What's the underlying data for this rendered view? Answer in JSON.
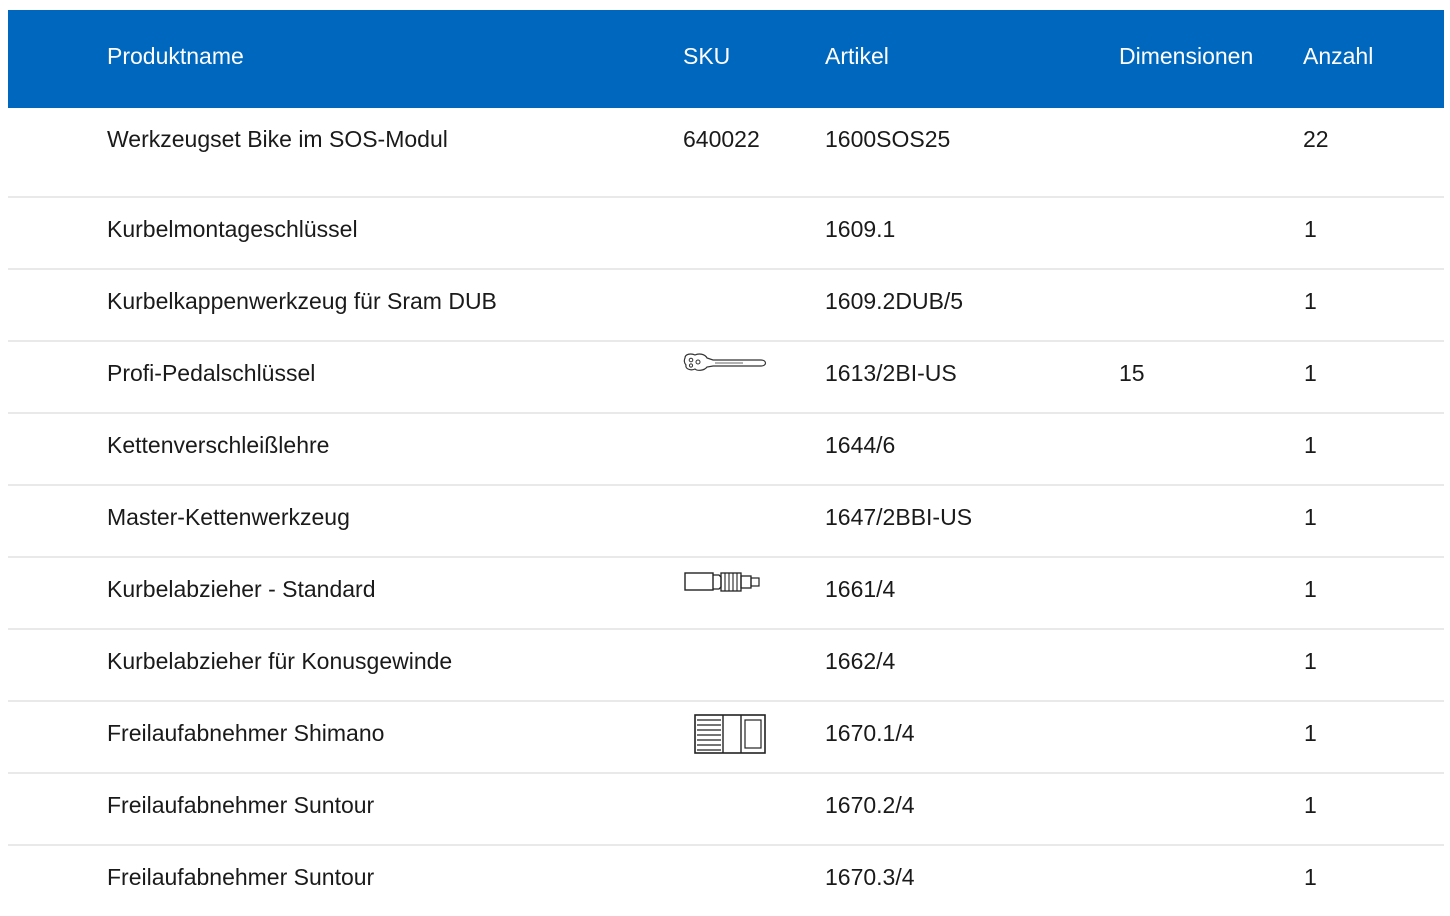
{
  "table": {
    "headers": {
      "name": "Produktname",
      "sku": "SKU",
      "article": "Artikel",
      "dimensions": "Dimensionen",
      "quantity": "Anzahl"
    },
    "rows": [
      {
        "name": "Werkzeugset Bike im SOS-Modul",
        "sku": "640022",
        "article": "1600SOS25",
        "dimensions": "",
        "quantity": "22",
        "icon": ""
      },
      {
        "name": "Kurbelmontageschlüssel",
        "sku": "",
        "article": "1609.1",
        "dimensions": "",
        "quantity": "1",
        "icon": ""
      },
      {
        "name": "Kurbelkappenwerkzeug für Sram DUB",
        "sku": "",
        "article": "1609.2DUB/5",
        "dimensions": "",
        "quantity": "1",
        "icon": ""
      },
      {
        "name": "Profi-Pedalschlüssel",
        "sku": "",
        "article": "1613/2BI-US",
        "dimensions": "15",
        "quantity": "1",
        "icon": "pedal-wrench-icon"
      },
      {
        "name": "Kettenverschleißlehre",
        "sku": "",
        "article": "1644/6",
        "dimensions": "",
        "quantity": "1",
        "icon": ""
      },
      {
        "name": "Master-Kettenwerkzeug",
        "sku": "",
        "article": "1647/2BBI-US",
        "dimensions": "",
        "quantity": "1",
        "icon": ""
      },
      {
        "name": "Kurbelabzieher - Standard",
        "sku": "",
        "article": "1661/4",
        "dimensions": "",
        "quantity": "1",
        "icon": "crank-puller-icon"
      },
      {
        "name": "Kurbelabzieher für Konusgewinde",
        "sku": "",
        "article": "1662/4",
        "dimensions": "",
        "quantity": "1",
        "icon": ""
      },
      {
        "name": "Freilaufabnehmer Shimano",
        "sku": "",
        "article": "1670.1/4",
        "dimensions": "",
        "quantity": "1",
        "icon": "freewheel-remover-icon"
      },
      {
        "name": "Freilaufabnehmer Suntour",
        "sku": "",
        "article": "1670.2/4",
        "dimensions": "",
        "quantity": "1",
        "icon": ""
      },
      {
        "name": "Freilaufabnehmer Suntour",
        "sku": "",
        "article": "1670.3/4",
        "dimensions": "",
        "quantity": "1",
        "icon": ""
      }
    ]
  },
  "colors": {
    "header_background": "#0067be",
    "header_text": "#ffffff",
    "row_divider": "#e9e9e9"
  }
}
